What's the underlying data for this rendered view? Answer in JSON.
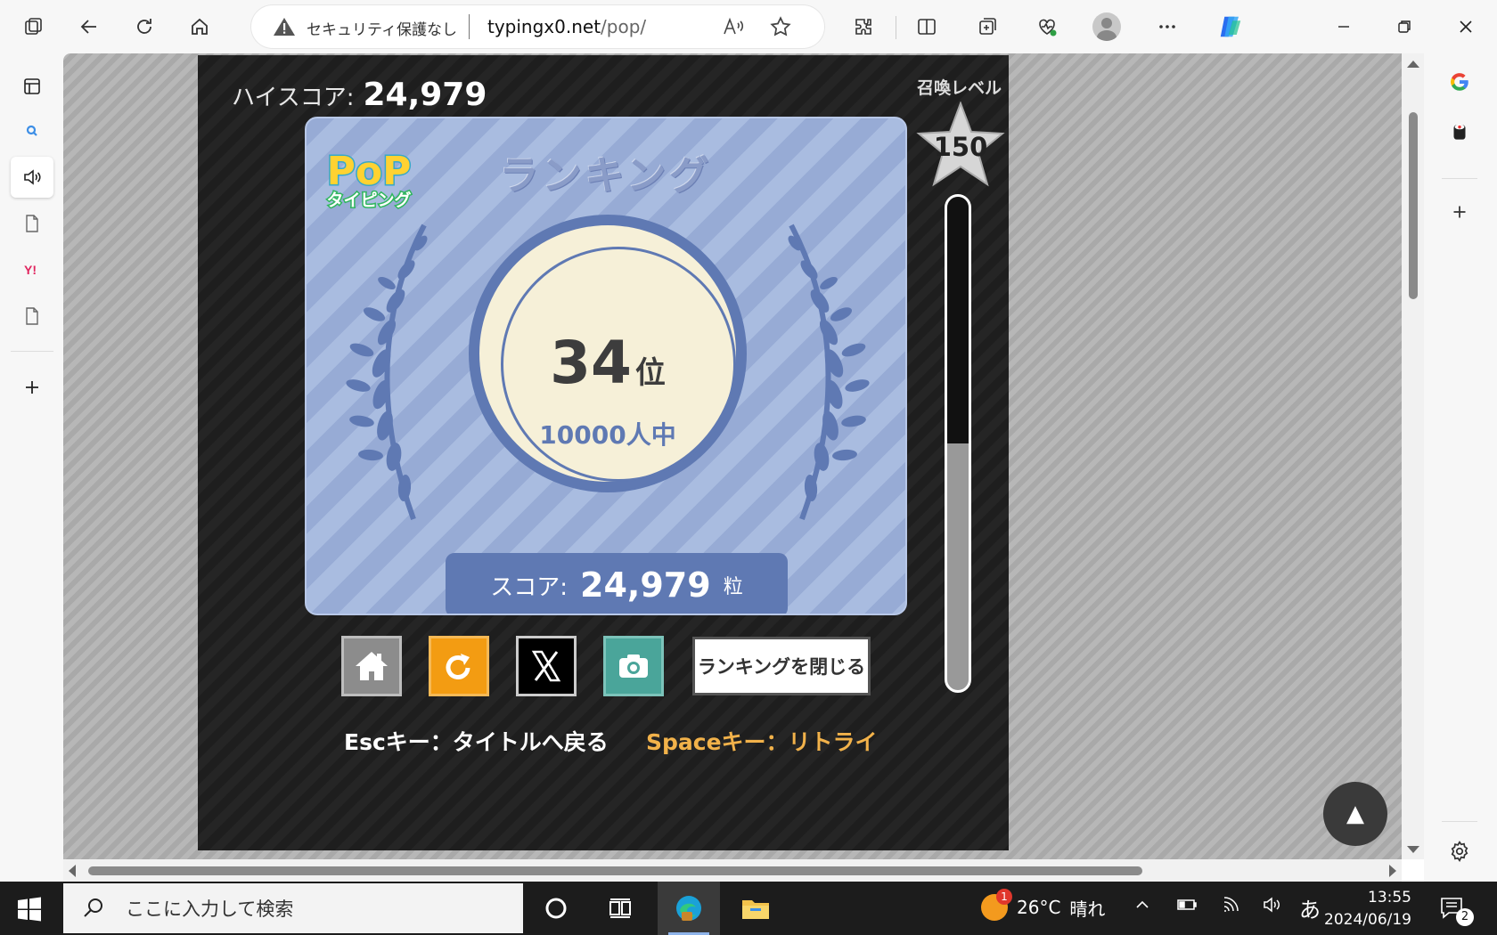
{
  "browser": {
    "security_text": "セキュリティ保護なし",
    "url_host": "typingx0.net",
    "url_path": "/pop/",
    "read_aloud_glyph": "A͂"
  },
  "game": {
    "highscore_label": "ハイスコア:",
    "highscore_value": "24,979",
    "ranking_title": "ランキング",
    "logo_top": "PoP",
    "logo_bottom": "タイピング",
    "rank_number": "34",
    "rank_suffix": "位",
    "rank_of": "10000人中",
    "score_label": "スコア:",
    "score_value": "24,979",
    "score_unit": "粒",
    "summon_level_label": "召喚レベル",
    "summon_level_value": "150",
    "gauge_fill_fraction": 0.5,
    "close_ranking_label": "ランキングを閉じる",
    "esc_hint": "Escキー：タイトルへ戻る",
    "space_hint": "Spaceキー：リトライ",
    "scroll_top_glyph": "▲"
  },
  "taskbar": {
    "search_placeholder": "ここに入力して検索",
    "weather_temp": "26°C",
    "weather_cond": "晴れ",
    "weather_badge": "1",
    "ime": "あ",
    "time": "13:55",
    "date": "2024/06/19",
    "notification_count": "2"
  },
  "colors": {
    "panel_blue": "#97abd5",
    "medal_blue": "#5f79b3",
    "retry_orange": "#f39c12",
    "camera_teal": "#4aa59a",
    "space_hint": "#f2b24a"
  }
}
